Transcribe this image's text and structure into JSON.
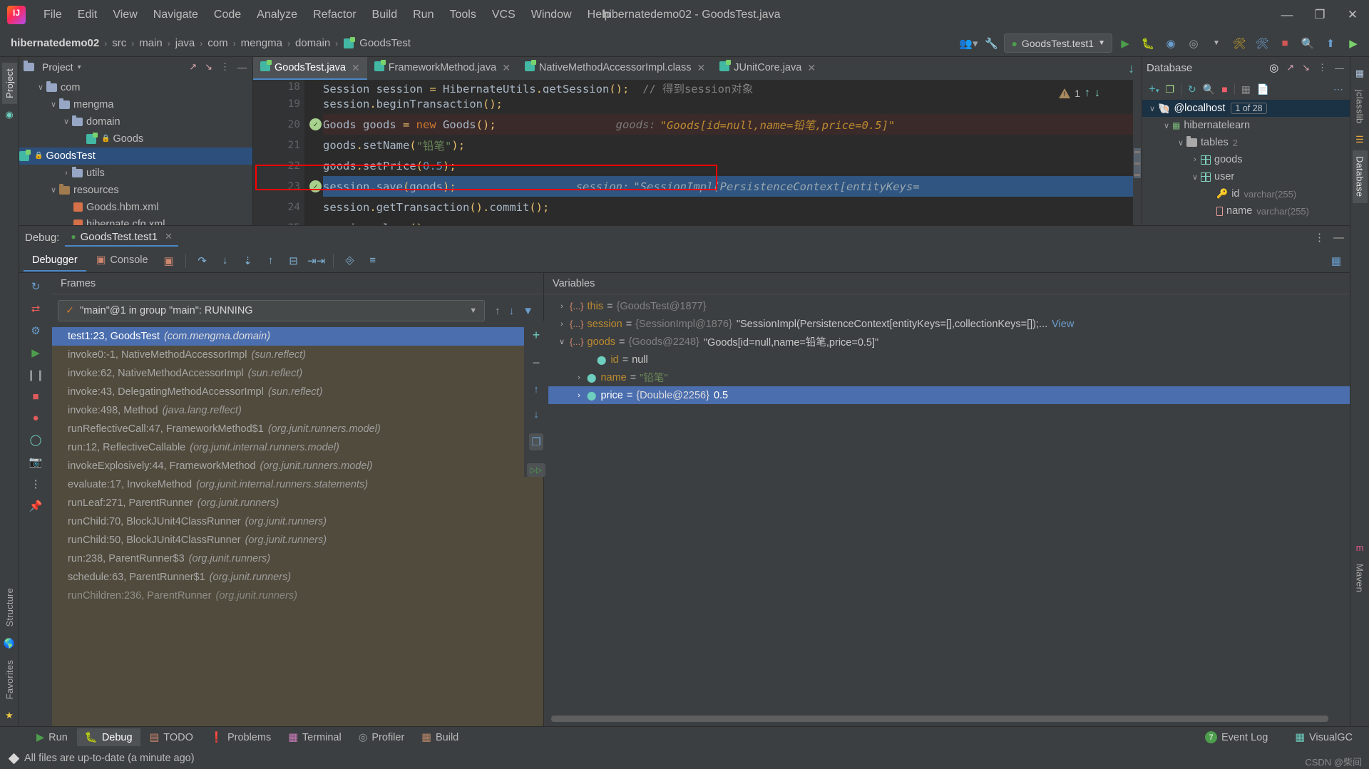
{
  "window": {
    "title": "hibernatedemo02 - GoodsTest.java",
    "minimize": "—",
    "maximize": "❐",
    "close": "✕"
  },
  "menu": {
    "items": [
      "File",
      "Edit",
      "View",
      "Navigate",
      "Code",
      "Analyze",
      "Refactor",
      "Build",
      "Run",
      "Tools",
      "VCS",
      "Window",
      "Help"
    ]
  },
  "breadcrumb": {
    "items": [
      "hibernatedemo02",
      "src",
      "main",
      "java",
      "com",
      "mengma",
      "domain",
      "GoodsTest"
    ],
    "separator": "›"
  },
  "toolbar": {
    "run_config": "GoodsTest.test1",
    "icons": [
      "people-icon",
      "wrench-icon",
      "run-icon",
      "debug-icon",
      "run-coverage-icon",
      "chevron-down-icon",
      "profiler-icon",
      "build-icon",
      "stop-icon",
      "search-icon",
      "update-icon",
      "plugin-icon"
    ]
  },
  "project": {
    "title": "Project",
    "selector": "▾",
    "tree": [
      {
        "depth": 1,
        "arrow": "∨",
        "icon": "folder-icon",
        "label": "com",
        "dim": ""
      },
      {
        "depth": 2,
        "arrow": "∨",
        "icon": "folder-icon",
        "label": "mengma",
        "dim": ""
      },
      {
        "depth": 3,
        "arrow": "∨",
        "icon": "folder-icon",
        "label": "domain",
        "dim": ""
      },
      {
        "depth": 4,
        "arrow": "",
        "icon": "class-icon",
        "label": "Goods",
        "dim": ""
      },
      {
        "depth": 4,
        "arrow": "",
        "icon": "class-icon",
        "label": "GoodsTest",
        "dim": "",
        "selected": true
      },
      {
        "depth": 3,
        "arrow": "›",
        "icon": "folder-icon",
        "label": "utils",
        "dim": ""
      },
      {
        "depth": 2,
        "arrow": "∨",
        "icon": "resources-folder-icon",
        "label": "resources",
        "dim": ""
      },
      {
        "depth": 3,
        "arrow": "",
        "icon": "xml-icon",
        "label": "Goods.hbm.xml",
        "dim": ""
      },
      {
        "depth": 3,
        "arrow": "",
        "icon": "xml-icon",
        "label": "hibernate.cfg.xml",
        "dim": ""
      }
    ]
  },
  "editor": {
    "tabs": [
      {
        "label": "GoodsTest.java",
        "active": true
      },
      {
        "label": "FrameworkMethod.java",
        "active": false
      },
      {
        "label": "NativeMethodAccessorImpl.class",
        "active": false
      },
      {
        "label": "JUnitCore.java",
        "active": false
      }
    ],
    "inspection_count": "1",
    "lines": [
      {
        "num": "18",
        "text": "Session session = HibernateUtils.getSession();",
        "comment": "// 得到session对象",
        "state": "partial"
      },
      {
        "num": "19",
        "text": "session.beginTransaction();",
        "state": "normal"
      },
      {
        "num": "20",
        "text": "Goods goods = new Goods();",
        "hint_label": "goods:",
        "hint_value": "\"Goods[id=null,name=铅笔,price=0.5]\"",
        "state": "exec",
        "check": true
      },
      {
        "num": "21",
        "text": "goods.setName(\"铅笔\");",
        "state": "normal"
      },
      {
        "num": "22",
        "text": "goods.setPrice(0.5);",
        "state": "normal"
      },
      {
        "num": "23",
        "text": "session.save(goods);",
        "hint_label": "session:",
        "hint_value": "\"SessionImpl(PersistenceContext[entityKeys=",
        "state": "cursor",
        "check": true,
        "highlight_box": true
      },
      {
        "num": "24",
        "text": "session.getTransaction().commit();",
        "state": "normal"
      },
      {
        "num": "25",
        "text": "session.close();",
        "state": "normal"
      }
    ]
  },
  "database": {
    "title": "Database",
    "toolbar_icons": [
      "add-icon",
      "copy-icon",
      "refresh-icon",
      "query-console-icon",
      "stop-icon",
      "table-icon",
      "script-icon",
      "more-icon"
    ],
    "tree": [
      {
        "depth": 0,
        "arrow": "∨",
        "icon": "mysql-icon",
        "label": "@localhost",
        "chip": "1 of 28",
        "selected": true
      },
      {
        "depth": 1,
        "arrow": "∨",
        "icon": "schema-icon",
        "label": "hibernatelearn",
        "chip": ""
      },
      {
        "depth": 2,
        "arrow": "∨",
        "icon": "folder-icon",
        "label": "tables",
        "dim": "2"
      },
      {
        "depth": 3,
        "arrow": "›",
        "icon": "table-icon",
        "label": "goods",
        "dim": ""
      },
      {
        "depth": 3,
        "arrow": "∨",
        "icon": "table-icon",
        "label": "user",
        "dim": ""
      },
      {
        "depth": 4,
        "arrow": "",
        "icon": "key-icon",
        "label": "id",
        "dim": "varchar(255)"
      },
      {
        "depth": 4,
        "arrow": "",
        "icon": "column-icon",
        "label": "name",
        "dim": "varchar(255)"
      }
    ]
  },
  "debug": {
    "label": "Debug:",
    "session": "GoodsTest.test1",
    "tabs": [
      {
        "label": "Debugger",
        "icon": "",
        "active": true
      },
      {
        "label": "Console",
        "icon": "console-icon",
        "active": false
      }
    ],
    "step_buttons": [
      "layout-icon",
      "step-over-icon",
      "step-into-icon",
      "force-step-into-icon",
      "step-out-icon",
      "drop-frame-icon",
      "run-to-cursor-icon",
      "evaluate-icon",
      "settings-icon"
    ],
    "left_icons": [
      "rerun-icon",
      "edit-config-icon",
      "settings-icon",
      "resume-icon",
      "pause-icon",
      "stop-icon",
      "mute-breakpoints-icon",
      "view-breakpoints-icon",
      "camera-icon",
      "more-icon",
      "pin-icon"
    ],
    "frames": {
      "title": "Frames",
      "thread": "\"main\"@1 in group \"main\": RUNNING",
      "items": [
        {
          "text": "test1:23, GoodsTest",
          "pkg": "(com.mengma.domain)",
          "selected": true
        },
        {
          "text": "invoke0:-1, NativeMethodAccessorImpl",
          "pkg": "(sun.reflect)"
        },
        {
          "text": "invoke:62, NativeMethodAccessorImpl",
          "pkg": "(sun.reflect)"
        },
        {
          "text": "invoke:43, DelegatingMethodAccessorImpl",
          "pkg": "(sun.reflect)"
        },
        {
          "text": "invoke:498, Method",
          "pkg": "(java.lang.reflect)"
        },
        {
          "text": "runReflectiveCall:47, FrameworkMethod$1",
          "pkg": "(org.junit.runners.model)"
        },
        {
          "text": "run:12, ReflectiveCallable",
          "pkg": "(org.junit.internal.runners.model)"
        },
        {
          "text": "invokeExplosively:44, FrameworkMethod",
          "pkg": "(org.junit.runners.model)"
        },
        {
          "text": "evaluate:17, InvokeMethod",
          "pkg": "(org.junit.internal.runners.statements)"
        },
        {
          "text": "runLeaf:271, ParentRunner",
          "pkg": "(org.junit.runners)"
        },
        {
          "text": "runChild:70, BlockJUnit4ClassRunner",
          "pkg": "(org.junit.runners)"
        },
        {
          "text": "runChild:50, BlockJUnit4ClassRunner",
          "pkg": "(org.junit.runners)"
        },
        {
          "text": "run:238, ParentRunner$3",
          "pkg": "(org.junit.runners)"
        },
        {
          "text": "schedule:63, ParentRunner$1",
          "pkg": "(org.junit.runners)"
        },
        {
          "text": "runChildren:236, ParentRunner",
          "pkg": "(org.junit.runners)"
        }
      ]
    },
    "variables": {
      "title": "Variables",
      "items": [
        {
          "indent": 0,
          "arrow": "›",
          "icon": "object-icon",
          "name": "this",
          "eq": "=",
          "type": "{GoodsTest@1877}",
          "value": "",
          "link": ""
        },
        {
          "indent": 0,
          "arrow": "›",
          "icon": "object-icon",
          "name": "session",
          "eq": "=",
          "type": "{SessionImpl@1876}",
          "value": "\"SessionImpl(PersistenceContext[entityKeys=[],collectionKeys=[]);...",
          "link": "View"
        },
        {
          "indent": 0,
          "arrow": "∨",
          "icon": "object-icon",
          "name": "goods",
          "eq": "=",
          "type": "{Goods@2248}",
          "value": "\"Goods[id=null,name=铅笔,price=0.5]\"",
          "link": ""
        },
        {
          "indent": 1,
          "arrow": "",
          "icon": "field-icon",
          "name": "id",
          "eq": "=",
          "type": "",
          "value": "null",
          "link": ""
        },
        {
          "indent": 1,
          "arrow": "›",
          "icon": "field-icon",
          "name": "name",
          "eq": "=",
          "type": "",
          "value": "\"铅笔\"",
          "link": "",
          "green": true
        },
        {
          "indent": 1,
          "arrow": "›",
          "icon": "field-icon",
          "name": "price",
          "eq": "=",
          "type": "{Double@2256}",
          "value": "0.5",
          "link": "",
          "selected": true
        }
      ]
    }
  },
  "toolwindows": {
    "left": [
      {
        "label": "Run",
        "icon": "run-icon",
        "active": false
      },
      {
        "label": "Debug",
        "icon": "debug-icon",
        "active": true
      },
      {
        "label": "TODO",
        "icon": "todo-icon",
        "active": false
      },
      {
        "label": "Problems",
        "icon": "problems-icon",
        "active": false
      },
      {
        "label": "Terminal",
        "icon": "terminal-icon",
        "active": false
      },
      {
        "label": "Profiler",
        "icon": "profiler-icon",
        "active": false
      },
      {
        "label": "Build",
        "icon": "build-icon",
        "active": false
      }
    ],
    "right": [
      {
        "label": "Event Log",
        "icon": "event-log-icon",
        "badge": "7"
      },
      {
        "label": "VisualGC",
        "icon": "visualgc-icon",
        "badge": ""
      }
    ]
  },
  "sidebars": {
    "left": [
      "Project",
      "Structure",
      "Favorites"
    ],
    "right": [
      "jclasslib",
      "Database",
      "Maven"
    ]
  },
  "statusbar": {
    "message": "All files are up-to-date (a minute ago)",
    "watermark": "CSDN @柴间"
  },
  "colors": {
    "accent": "#4a88c7",
    "selection": "#2d4f7c",
    "frame_selection": "#4b6eaf",
    "exec_line": "#3b2a2a",
    "marker_red": "#ff0000",
    "string_green": "#6a8759",
    "keyword_orange": "#cc7832",
    "number_blue": "#6897bb"
  }
}
